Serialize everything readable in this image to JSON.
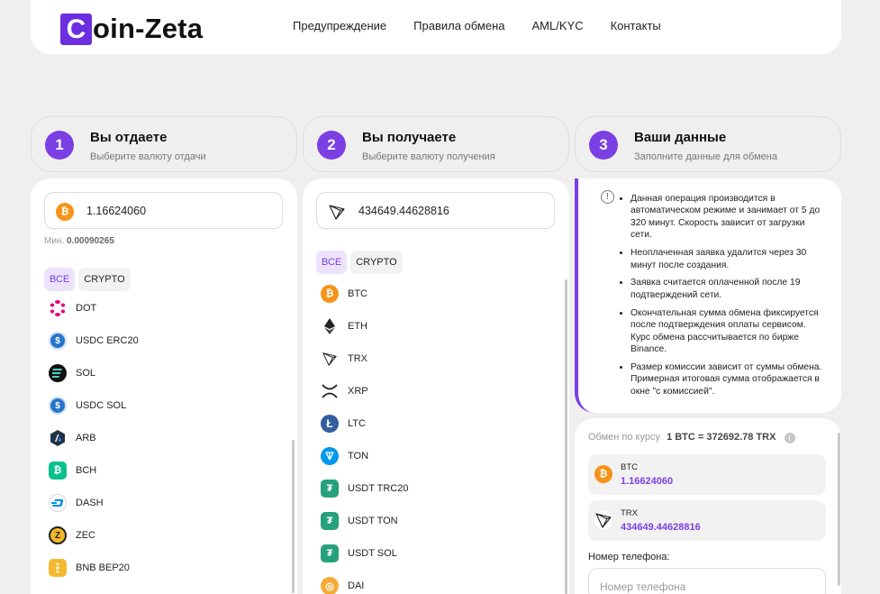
{
  "logo": {
    "letter": "C",
    "rest": "oin-Zeta"
  },
  "nav": [
    "Предупреждение",
    "Правила обмена",
    "AML/KYC",
    "Контакты"
  ],
  "steps": [
    {
      "num": "1",
      "title": "Вы отдаете",
      "sub": "Выберите валюту отдачи"
    },
    {
      "num": "2",
      "title": "Вы получаете",
      "sub": "Выберите валюту получения"
    },
    {
      "num": "3",
      "title": "Ваши данные",
      "sub": "Заполните данные для обмена"
    }
  ],
  "give": {
    "amount": "1.16624060",
    "min_label": "Мин.",
    "min_value": "0.00090265",
    "filters": [
      "ВСЕ",
      "CRYPTO"
    ],
    "coins": [
      {
        "label": "DOT",
        "icon": "polkadot-icon"
      },
      {
        "label": "USDC ERC20",
        "icon": "usdc-icon"
      },
      {
        "label": "SOL",
        "icon": "solana-icon"
      },
      {
        "label": "USDC SOL",
        "icon": "usdc-icon"
      },
      {
        "label": "ARB",
        "icon": "arbitrum-icon"
      },
      {
        "label": "BCH",
        "icon": "bitcoin-cash-icon"
      },
      {
        "label": "DASH",
        "icon": "dash-icon"
      },
      {
        "label": "ZEC",
        "icon": "zcash-icon"
      },
      {
        "label": "BNB BEP20",
        "icon": "bnb-icon"
      }
    ]
  },
  "receive": {
    "amount": "434649.44628816",
    "filters": [
      "ВСЕ",
      "CRYPTO"
    ],
    "coins": [
      {
        "label": "BTC",
        "icon": "bitcoin-icon"
      },
      {
        "label": "ETH",
        "icon": "ethereum-icon"
      },
      {
        "label": "TRX",
        "icon": "tron-icon"
      },
      {
        "label": "XRP",
        "icon": "xrp-icon"
      },
      {
        "label": "LTC",
        "icon": "litecoin-icon"
      },
      {
        "label": "TON",
        "icon": "ton-icon"
      },
      {
        "label": "USDT TRC20",
        "icon": "tether-icon"
      },
      {
        "label": "USDT TON",
        "icon": "tether-icon"
      },
      {
        "label": "USDT SOL",
        "icon": "tether-icon"
      },
      {
        "label": "DAI",
        "icon": "dai-icon"
      }
    ]
  },
  "info": {
    "icon": "!",
    "items": [
      "Данная операция производится в автоматическом режиме и занимает от 5 до 320 минут. Скорость зависит от загрузки сети.",
      "Неоплаченная заявка удалится через 30 минут после создания.",
      "Заявка считается оплаченной после 19 подтверждений сети.",
      "Окончательная сумма обмена фиксируется после подтверждения оплаты сервисом. Курс обмена рассчитывается по бирже Binance.",
      "Размер комиссии зависит от суммы обмена. Примерная итоговая сумма отображается в окне \"с комиссией\"."
    ]
  },
  "summary": {
    "rate_label": "Обмен по курсу",
    "rate_value": "1 BTC = 372692.78 TRX",
    "rate_info_icon": "i",
    "give": {
      "name": "BTC",
      "value": "1.16624060"
    },
    "get": {
      "name": "TRX",
      "value": "434649.44628816"
    },
    "phone_label": "Номер телефона:",
    "phone_placeholder": "Номер телефона"
  },
  "colors": {
    "accent": "#7b3fe4",
    "background": "#efefef",
    "btc": "#f7931a",
    "usdt": "#26a17b"
  }
}
